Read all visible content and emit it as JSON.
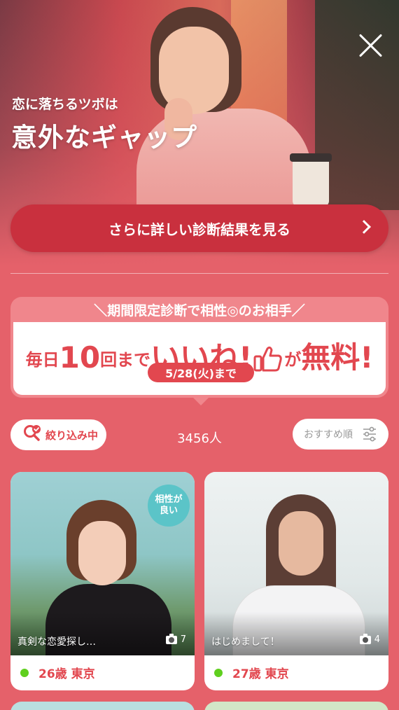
{
  "hero": {
    "subtitle": "恋に落ちるツボは",
    "title": "意外なギャップ",
    "detail_button_label": "さらに詳しい診断結果を見る"
  },
  "banner": {
    "header": "＼期間限定診断で相性◎のお相手／",
    "main": {
      "part1": "毎日",
      "number": "10",
      "part2": "回まで",
      "iine": "いいね!",
      "part3": "が",
      "free": "無料!"
    },
    "deadline": "5/28(火)まで"
  },
  "filters": {
    "filter_label": "絞り込み中",
    "result_count": "3456人",
    "sort_label": "おすすめ順"
  },
  "cards": [
    {
      "caption": "真剣な恋愛探し…",
      "photo_count": "7",
      "age_location": "26歳 東京",
      "badge": [
        "相性が",
        "良い"
      ],
      "online_color": "#5fcf1e"
    },
    {
      "caption": "はじめまして！",
      "photo_count": "4",
      "age_location": "27歳 東京",
      "online_color": "#5fcf1e"
    }
  ],
  "icons": {
    "close": "close-icon",
    "chevron": "chevron-right-icon",
    "filter": "search-filter-icon",
    "sort": "sliders-icon",
    "camera": "camera-icon",
    "like": "thumbs-up-icon"
  },
  "colors": {
    "background": "#e5616a",
    "accent": "#e2474f",
    "button_dark": "#c9303e",
    "badge": "#5bc4c8",
    "online": "#5fcf1e"
  }
}
